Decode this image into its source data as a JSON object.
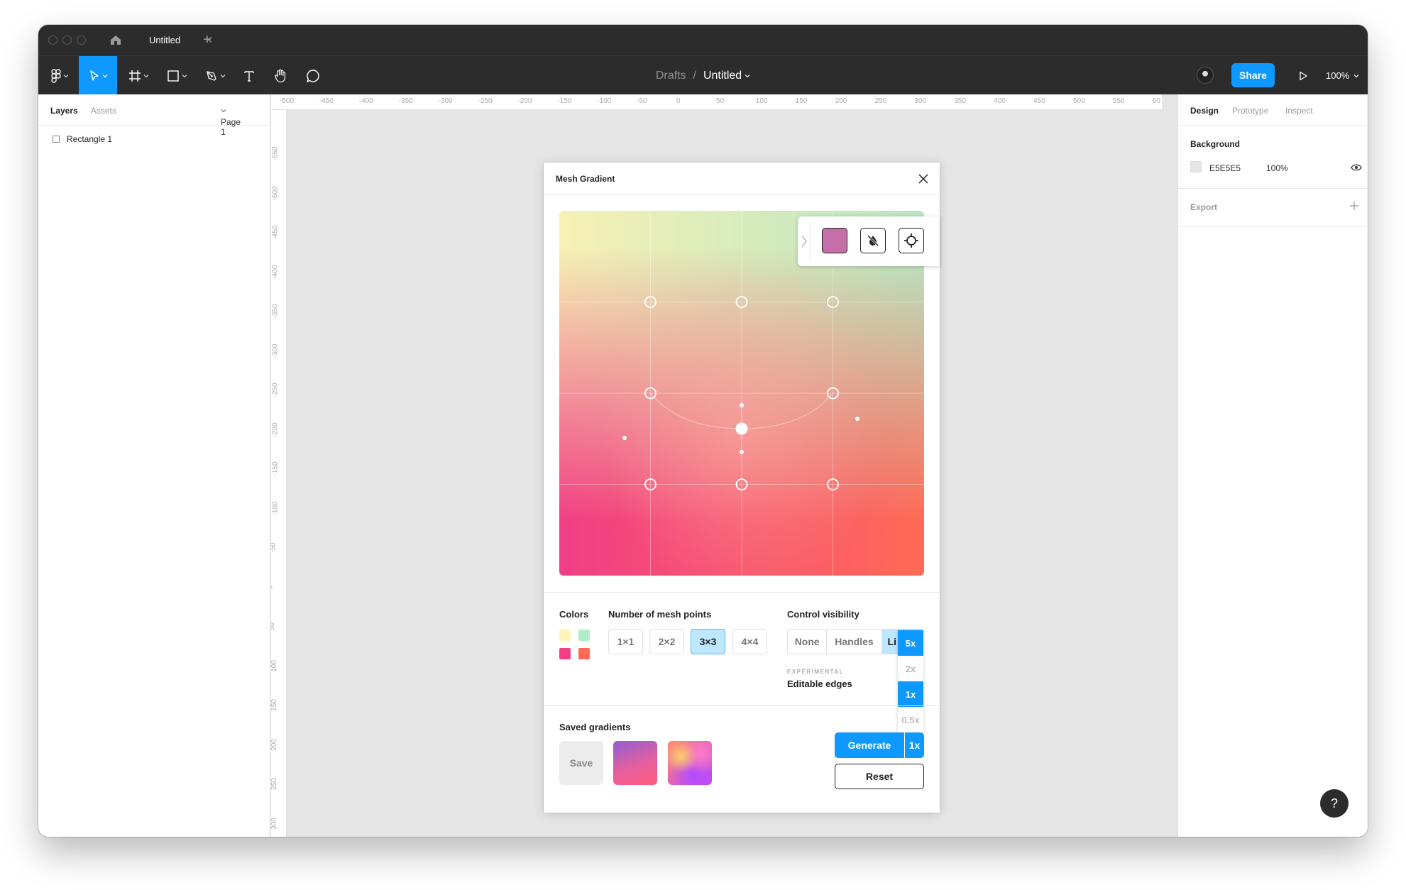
{
  "titlebar": {
    "tab_title": "Untitled"
  },
  "breadcrumb": {
    "parent": "Drafts",
    "separator": "/",
    "current": "Untitled"
  },
  "toolbar": {
    "share_label": "Share",
    "zoom": "100%"
  },
  "left_panel": {
    "tabs": [
      "Layers",
      "Assets"
    ],
    "page": "Page 1",
    "layers": [
      {
        "name": "Rectangle 1"
      }
    ]
  },
  "rulers": {
    "horizontal": [
      "-500",
      "-450",
      "-400",
      "-350",
      "-300",
      "-250",
      "-200",
      "-150",
      "-100",
      "-50",
      "0",
      "50",
      "100",
      "150",
      "200",
      "250",
      "300",
      "350",
      "400",
      "450",
      "500",
      "550",
      "60"
    ],
    "vertical": [
      "-550",
      "-500",
      "-450",
      "-400",
      "-350",
      "-300",
      "-250",
      "-200",
      "-150",
      "-100",
      "-50",
      "0",
      "50",
      "100",
      "150",
      "200",
      "250",
      "300"
    ]
  },
  "right_panel": {
    "tabs": [
      "Design",
      "Prototype",
      "Inspect"
    ],
    "background_label": "Background",
    "background_hex": "E5E5E5",
    "background_opacity": "100%",
    "export_label": "Export"
  },
  "plugin": {
    "title": "Mesh Gradient",
    "swatch_color": "#c46fa8",
    "colors_label": "Colors",
    "colors": [
      "#fdf4b8",
      "#b4ecc8",
      "#f03f85",
      "#ff6a56"
    ],
    "mesh_label": "Number of mesh points",
    "mesh_options": [
      "1×1",
      "2×2",
      "3×3",
      "4×4"
    ],
    "mesh_selected": "3×3",
    "visibility_label": "Control visibility",
    "visibility_options": [
      "None",
      "Handles",
      "Li"
    ],
    "experimental": "EXPERIMENTAL",
    "editable_edges": "Editable edges",
    "scale_options": [
      "5x",
      "2x",
      "1x",
      "0.5x"
    ],
    "saved_label": "Saved gradients",
    "save_btn": "Save",
    "generate_btn": "Generate",
    "generate_scale": "1x",
    "reset_btn": "Reset"
  },
  "help": "?"
}
